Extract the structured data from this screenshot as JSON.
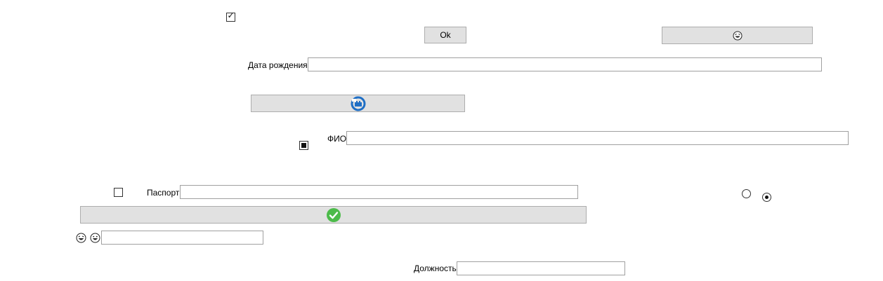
{
  "checkboxes": {
    "top": {
      "state": "checked"
    },
    "fio": {
      "state": "indeterminate"
    },
    "passport": {
      "state": "unchecked"
    }
  },
  "buttons": {
    "ok_label": "Ok",
    "emoji_button_icon": "laughing-face-icon",
    "sync_button_icon": "sync-icon",
    "confirm_button_icon": "checkmark-circle-icon"
  },
  "fields": {
    "birth_date": {
      "label": "Дата рождения",
      "value": ""
    },
    "fio": {
      "label": "ФИО",
      "value": ""
    },
    "passport": {
      "label": "Паспорт",
      "value": ""
    },
    "emoji_field": {
      "value": ""
    },
    "position": {
      "label": "Должность",
      "value": ""
    }
  },
  "radios": [
    {
      "selected": false
    },
    {
      "selected": true
    }
  ],
  "icons": {
    "emoji_left": "laughing-face-icon",
    "emoji_right": "grinning-face-icon"
  },
  "colors": {
    "button_bg": "#e1e1e1",
    "sync_blue": "#1f6fc5",
    "check_green": "#4cbb4a"
  }
}
